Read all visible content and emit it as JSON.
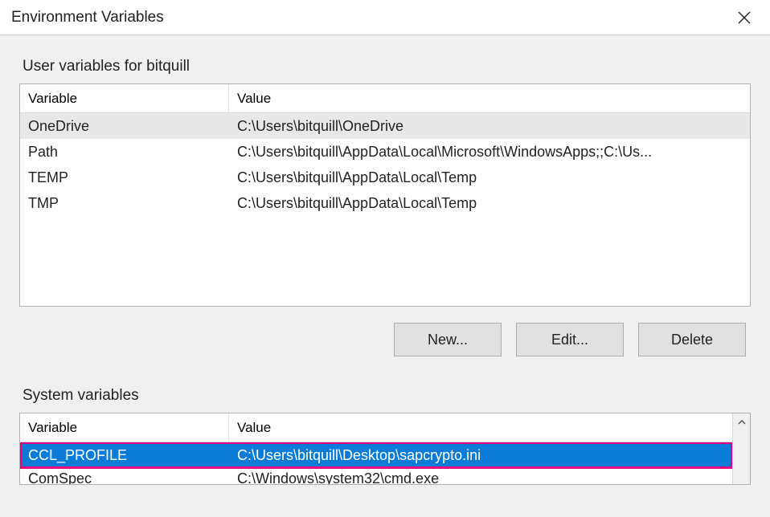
{
  "window": {
    "title": "Environment Variables"
  },
  "user_section": {
    "label": "User variables for bitquill",
    "columns": {
      "variable": "Variable",
      "value": "Value"
    },
    "rows": [
      {
        "variable": "OneDrive",
        "value": "C:\\Users\\bitquill\\OneDrive",
        "selected": true
      },
      {
        "variable": "Path",
        "value": "C:\\Users\\bitquill\\AppData\\Local\\Microsoft\\WindowsApps;;C:\\Us..."
      },
      {
        "variable": "TEMP",
        "value": "C:\\Users\\bitquill\\AppData\\Local\\Temp"
      },
      {
        "variable": "TMP",
        "value": "C:\\Users\\bitquill\\AppData\\Local\\Temp"
      }
    ],
    "buttons": {
      "new": "New...",
      "edit": "Edit...",
      "delete": "Delete"
    }
  },
  "system_section": {
    "label": "System variables",
    "columns": {
      "variable": "Variable",
      "value": "Value"
    },
    "rows": [
      {
        "variable": "CCL_PROFILE",
        "value": "C:\\Users\\bitquill\\Desktop\\sapcrypto.ini",
        "selected": true,
        "highlighted": true
      },
      {
        "variable": "ComSpec",
        "value": "C:\\Windows\\system32\\cmd.exe"
      }
    ]
  }
}
